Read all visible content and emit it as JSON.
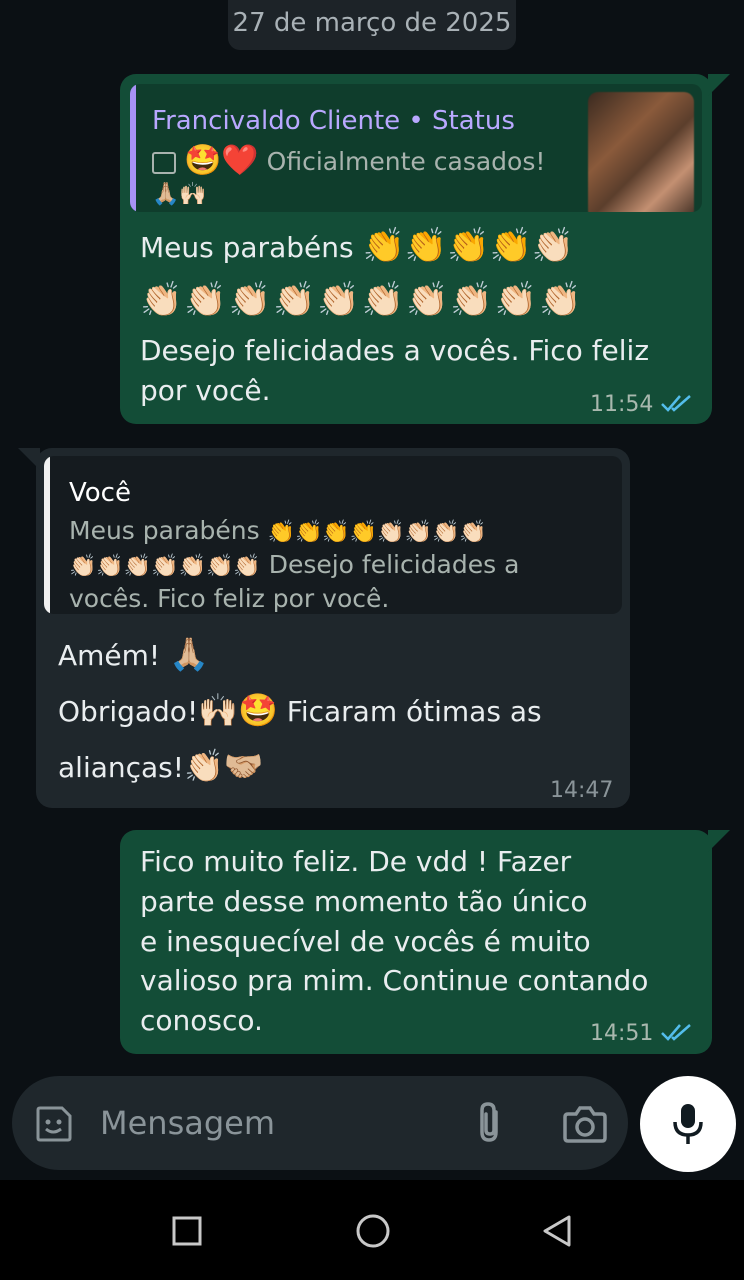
{
  "date_chip": "27 de março de 2025",
  "messages": {
    "m1": {
      "quote_title": "Francivaldo Cliente • Status",
      "quote_line1": "Oficialmente casados!",
      "quote_emoji1": "🤩❤️",
      "quote_emoji2": "🙏🏼🙌🏻",
      "body_line1": "Meus parabéns",
      "emoji_row1": "👏👏👏👏👏🏻",
      "emoji_row2": "👏🏻👏🏻👏🏻👏🏻👏🏻👏🏻👏🏻👏🏻👏🏻👏🏻",
      "body_line3": "Desejo felicidades a vocês. Fico feliz",
      "body_line4": "por você.",
      "time": "11:54"
    },
    "m2": {
      "quote_title": "Você",
      "quote_line1": "Meus parabéns",
      "quote_emoji1": "👏👏👏👏👏🏻👏🏻👏🏻👏🏻",
      "quote_emoji2": "👏🏻👏🏻👏🏻👏🏻👏🏻👏🏻👏🏻",
      "quote_line2": "Desejo felicidades a",
      "quote_line3": "vocês. Fico feliz por você.",
      "line1": "Amém!",
      "line1_emoji": "🙏🏼",
      "line2a": "Obrigado!",
      "line2_emoji": "🙌🏻🤩",
      "line2b": "Ficaram ótimas as",
      "line3": "alianças!",
      "line3_emoji": "👏🏻🤝🏼",
      "time": "14:47"
    },
    "m3": {
      "line1": "Fico muito feliz. De vdd !  Fazer",
      "line2": "parte desse momento tão único",
      "line3": "e inesquecível de vocês é muito",
      "line4": "valioso pra mim. Continue contando",
      "line5": "conosco.",
      "time": "14:51"
    }
  },
  "input": {
    "placeholder": "Mensagem"
  },
  "icons": {
    "sticker": "sticker-icon",
    "attach": "paperclip-icon",
    "camera": "camera-icon",
    "mic": "microphone-icon",
    "read_ticks": "double-check-icon",
    "nav_recent": "square-icon",
    "nav_home": "circle-icon",
    "nav_back": "triangle-back-icon"
  },
  "colors": {
    "outgoing_bubble": "#134d37",
    "incoming_bubble": "#1f272c",
    "read_ticks": "#53bdeb",
    "quote_accent_status": "#a792f5"
  }
}
